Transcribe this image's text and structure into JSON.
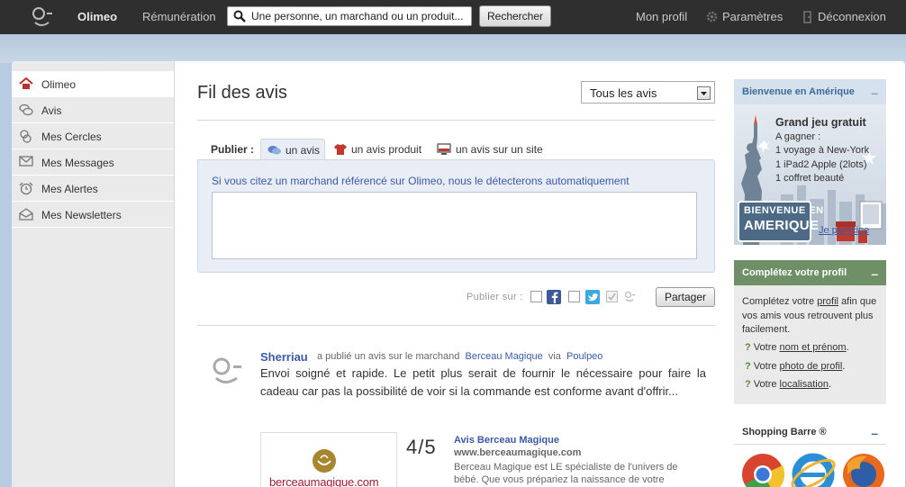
{
  "topbar": {
    "brand": "Olimeo",
    "remuneration": "Rémunération",
    "search_placeholder": "Une personne, un marchand ou un produit...",
    "search_button": "Rechercher",
    "profile": "Mon profil",
    "settings": "Paramètres",
    "logout": "Déconnexion"
  },
  "sidebar": {
    "items": [
      {
        "label": "Olimeo",
        "icon": "home-icon",
        "active": true
      },
      {
        "label": "Avis",
        "icon": "comments-icon"
      },
      {
        "label": "Mes Cercles",
        "icon": "circles-icon"
      },
      {
        "label": "Mes Messages",
        "icon": "envelope-icon"
      },
      {
        "label": "Mes Alertes",
        "icon": "alarm-clock-icon"
      },
      {
        "label": "Mes Newsletters",
        "icon": "newsletter-icon"
      }
    ]
  },
  "main": {
    "title": "Fil des avis",
    "filter": {
      "selected": "Tous les avis"
    },
    "publish": {
      "label": "Publier :",
      "tabs": [
        {
          "label": "un avis",
          "icon": "speech-bubble-icon",
          "active": true
        },
        {
          "label": "un avis produit",
          "icon": "tshirt-icon"
        },
        {
          "label": "un avis sur un site",
          "icon": "monitor-icon"
        }
      ],
      "hint": "Si vous citez un marchand référencé sur Olimeo, nous le détecterons automatiquement",
      "textarea_value": "",
      "share_label": "Publier sur :",
      "share_button": "Partager"
    },
    "post": {
      "author": "Sherriau",
      "action": "a publié un avis sur le marchand",
      "merchant": "Berceau Magique",
      "via_label": "via",
      "via": "Poulpeo",
      "body": "Envoi soigné et rapide. Le petit plus serait de fournir le nécessaire pour faire la cadeau car pas la possibilité de voir si la commande est conforme avant d'offrir...",
      "rating": "4/5",
      "merchant_title": "Avis Berceau Magique",
      "merchant_url": "www.berceaumagique.com",
      "merchant_desc": "Berceau Magique est LE spécialiste de l'univers de bébé. Que vous prépariez la naissance de votre",
      "logo_text": "berceaumagique.com"
    }
  },
  "right": {
    "promo": {
      "header": "Bienvenue en Amérique",
      "title": "Grand jeu gratuit",
      "lines": [
        "A gagner :",
        "1 voyage à New-York",
        "1 iPad2 Apple (2lots)",
        "1 coffret beauté"
      ],
      "badge_line1": "BIENVENUE EN",
      "badge_line2": "AMERIQUE",
      "link": "Je participe"
    },
    "profile": {
      "header": "Complétez votre profil",
      "text_before": "Complétez votre",
      "text_link": "profil",
      "text_after": "afin que vos amis vous retrouvent plus facilement.",
      "items": [
        {
          "prefix": "Votre",
          "link": "nom et prénom",
          "suffix": "."
        },
        {
          "prefix": "Votre",
          "link": "photo de profil",
          "suffix": "."
        },
        {
          "prefix": "Votre",
          "link": "localisation",
          "suffix": "."
        }
      ]
    },
    "shopping": {
      "header": "Shopping Barre ®",
      "browsers": [
        "chrome-icon",
        "internet-explorer-icon",
        "firefox-icon"
      ]
    }
  },
  "colors": {
    "topbar": "#2f2f2f",
    "link": "#3b5aa6",
    "green_header": "#6f8f67",
    "blue_header": "#d6e1ee"
  }
}
